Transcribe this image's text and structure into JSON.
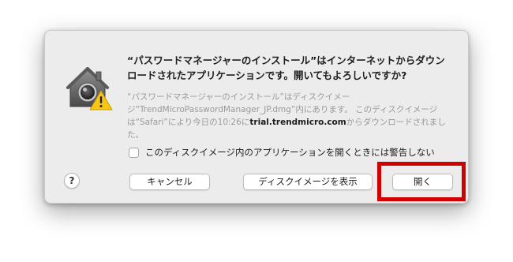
{
  "dialog": {
    "title": "“パスワードマネージャーのインストール”はインターネットからダウンロードされたアプリケーションです。開いてもよろしいですか?",
    "body_part1": "“パスワードマネージャーのインストール”はディスクイメージ“TrendMicroPasswordManager_JP.dmg”内にあります。 このディスクイメージは“Safari”により今日の10:26に",
    "body_domain": "trial.trendmicro.com",
    "body_part2": "からダウンロードされました。",
    "icon": "gatekeeper-warning-icon"
  },
  "checkbox": {
    "label": "このディスクイメージ内のアプリケーションを開くときには警告しない",
    "checked": false
  },
  "buttons": {
    "help_label": "?",
    "cancel_label": "キャンセル",
    "show_label": "ディスクイメージを表示",
    "open_label": "開く"
  },
  "colors": {
    "highlight": "#d00000",
    "warning": "#f5c518"
  }
}
